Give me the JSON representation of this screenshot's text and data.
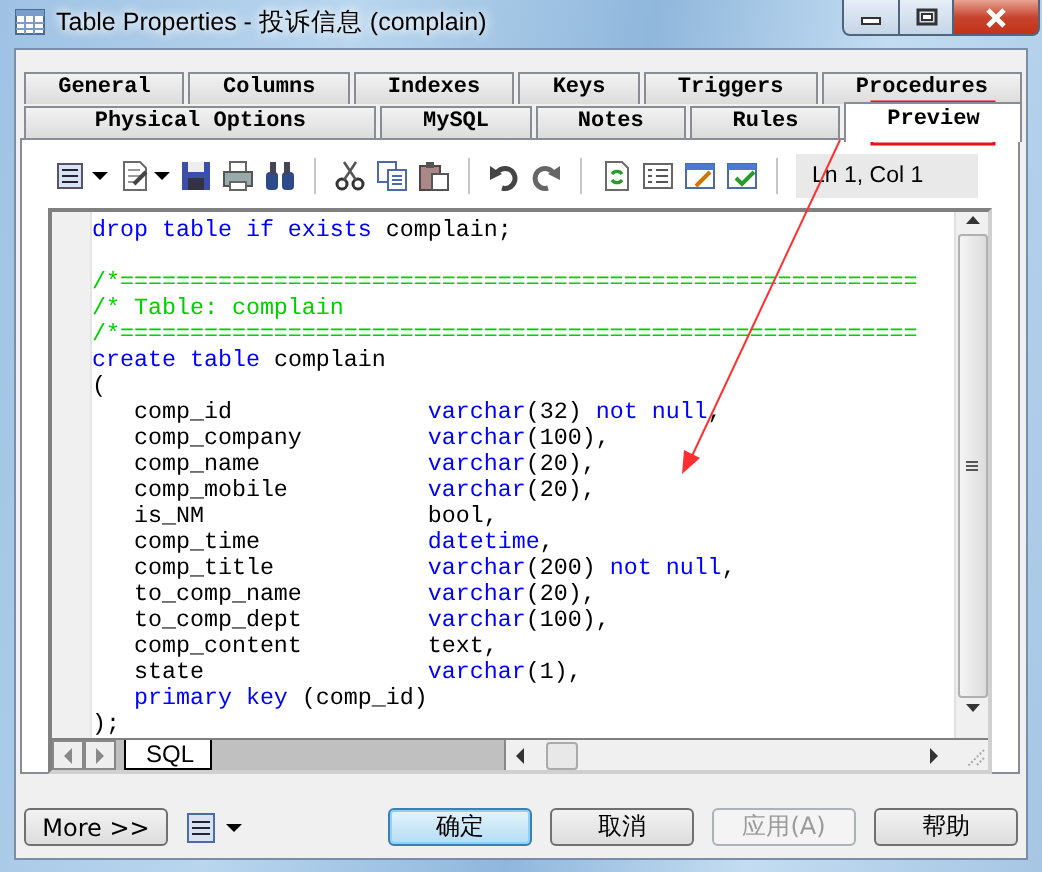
{
  "window": {
    "title": "Table Properties - 投诉信息 (complain)"
  },
  "tab_rows": [
    [
      {
        "label": "General",
        "selected": false
      },
      {
        "label": "Columns",
        "selected": false
      },
      {
        "label": "Indexes",
        "selected": false
      },
      {
        "label": "Keys",
        "selected": false
      },
      {
        "label": "Triggers",
        "selected": false
      },
      {
        "label": "Procedures",
        "selected": false
      }
    ],
    [
      {
        "label": "Physical Options",
        "selected": false
      },
      {
        "label": "MySQL",
        "selected": false
      },
      {
        "label": "Notes",
        "selected": false
      },
      {
        "label": "Rules",
        "selected": false
      },
      {
        "label": "Preview",
        "selected": true
      }
    ]
  ],
  "toolbar": {
    "position": "Ln 1, Col 1"
  },
  "editor": {
    "lines": [
      {
        "kind": "code",
        "segments": [
          {
            "kind": "keyword",
            "text": "drop table if exists"
          },
          {
            "kind": "plain",
            "text": " complain;"
          }
        ]
      },
      {
        "kind": "blank"
      },
      {
        "kind": "code",
        "segments": [
          {
            "kind": "comment",
            "text": "/*========================================================="
          }
        ]
      },
      {
        "kind": "code",
        "segments": [
          {
            "kind": "comment",
            "text": "/* Table: complain"
          }
        ]
      },
      {
        "kind": "code",
        "segments": [
          {
            "kind": "comment",
            "text": "/*========================================================="
          }
        ]
      },
      {
        "kind": "code",
        "segments": [
          {
            "kind": "keyword",
            "text": "create table"
          },
          {
            "kind": "plain",
            "text": " complain"
          }
        ]
      },
      {
        "kind": "code",
        "segments": [
          {
            "kind": "plain",
            "text": "("
          }
        ]
      },
      {
        "kind": "code",
        "segments": [
          {
            "kind": "plain",
            "text": "   comp_id              "
          },
          {
            "kind": "keyword",
            "text": "varchar"
          },
          {
            "kind": "plain",
            "text": "(32) "
          },
          {
            "kind": "keyword",
            "text": "not null"
          },
          {
            "kind": "plain",
            "text": ","
          }
        ]
      },
      {
        "kind": "code",
        "segments": [
          {
            "kind": "plain",
            "text": "   comp_company         "
          },
          {
            "kind": "keyword",
            "text": "varchar"
          },
          {
            "kind": "plain",
            "text": "(100),"
          }
        ]
      },
      {
        "kind": "code",
        "segments": [
          {
            "kind": "plain",
            "text": "   comp_name            "
          },
          {
            "kind": "keyword",
            "text": "varchar"
          },
          {
            "kind": "plain",
            "text": "(20),"
          }
        ]
      },
      {
        "kind": "code",
        "segments": [
          {
            "kind": "plain",
            "text": "   comp_mobile          "
          },
          {
            "kind": "keyword",
            "text": "varchar"
          },
          {
            "kind": "plain",
            "text": "(20),"
          }
        ]
      },
      {
        "kind": "code",
        "segments": [
          {
            "kind": "plain",
            "text": "   is_NM                bool,"
          }
        ]
      },
      {
        "kind": "code",
        "segments": [
          {
            "kind": "plain",
            "text": "   comp_time            "
          },
          {
            "kind": "keyword",
            "text": "datetime"
          },
          {
            "kind": "plain",
            "text": ","
          }
        ]
      },
      {
        "kind": "code",
        "segments": [
          {
            "kind": "plain",
            "text": "   comp_title           "
          },
          {
            "kind": "keyword",
            "text": "varchar"
          },
          {
            "kind": "plain",
            "text": "(200) "
          },
          {
            "kind": "keyword",
            "text": "not null"
          },
          {
            "kind": "plain",
            "text": ","
          }
        ]
      },
      {
        "kind": "code",
        "segments": [
          {
            "kind": "plain",
            "text": "   to_comp_name         "
          },
          {
            "kind": "keyword",
            "text": "varchar"
          },
          {
            "kind": "plain",
            "text": "(20),"
          }
        ]
      },
      {
        "kind": "code",
        "segments": [
          {
            "kind": "plain",
            "text": "   to_comp_dept         "
          },
          {
            "kind": "keyword",
            "text": "varchar"
          },
          {
            "kind": "plain",
            "text": "(100),"
          }
        ]
      },
      {
        "kind": "code",
        "segments": [
          {
            "kind": "plain",
            "text": "   comp_content         text,"
          }
        ]
      },
      {
        "kind": "code",
        "segments": [
          {
            "kind": "plain",
            "text": "   state                "
          },
          {
            "kind": "keyword",
            "text": "varchar"
          },
          {
            "kind": "plain",
            "text": "(1),"
          }
        ]
      },
      {
        "kind": "code",
        "segments": [
          {
            "kind": "keyword",
            "text": "   primary key"
          },
          {
            "kind": "plain",
            "text": " (comp_id)"
          }
        ]
      },
      {
        "kind": "code",
        "segments": [
          {
            "kind": "plain",
            "text": ");"
          }
        ]
      }
    ],
    "sheet_tabs": [
      {
        "label": "SQL",
        "selected": true
      }
    ]
  },
  "buttons": [
    {
      "label": "More >>",
      "disabled": false
    },
    {
      "label": "确定",
      "disabled": false,
      "default": true
    },
    {
      "label": "取消",
      "disabled": false,
      "default": false
    },
    {
      "label": "应用(A)",
      "disabled": true,
      "default": false
    },
    {
      "label": "帮助",
      "disabled": false,
      "default": false
    }
  ]
}
